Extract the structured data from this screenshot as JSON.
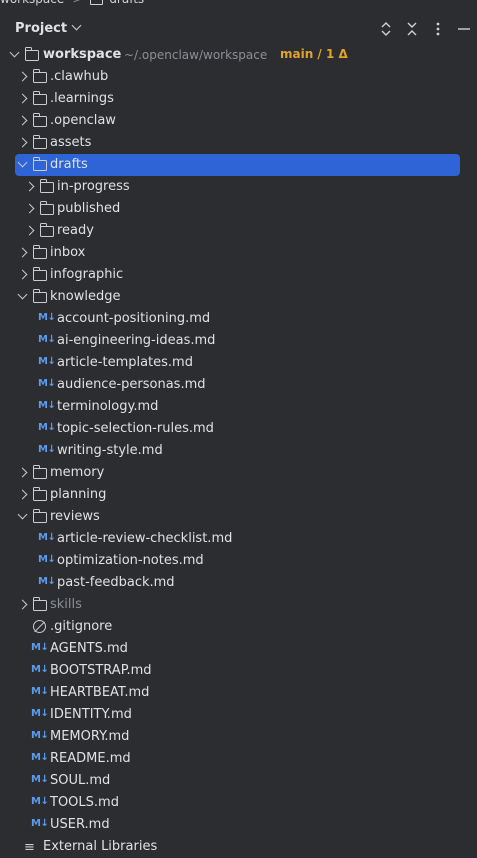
{
  "breadcrumb": {
    "items": [
      "workspace",
      "drafts"
    ]
  },
  "panel": {
    "title": "Project"
  },
  "toolbar": {
    "icons": [
      "chevron-up-down-icon",
      "collapse-all-icon",
      "more-options-icon",
      "minimize-icon"
    ]
  },
  "root": {
    "label": "workspace",
    "path": "~/.openclaw/workspace",
    "branch": "main / 1 Δ"
  },
  "tree": [
    {
      "label": ".clawhub",
      "type": "folder",
      "state": "closed"
    },
    {
      "label": ".learnings",
      "type": "folder",
      "state": "closed"
    },
    {
      "label": ".openclaw",
      "type": "folder",
      "state": "closed"
    },
    {
      "label": "assets",
      "type": "folder",
      "state": "closed"
    },
    {
      "label": "drafts",
      "type": "folder",
      "state": "open",
      "selected": true
    },
    {
      "label": "in-progress",
      "type": "folder",
      "state": "closed"
    },
    {
      "label": "published",
      "type": "folder",
      "state": "closed"
    },
    {
      "label": "ready",
      "type": "folder",
      "state": "closed"
    },
    {
      "label": "inbox",
      "type": "folder",
      "state": "closed"
    },
    {
      "label": "infographic",
      "type": "folder",
      "state": "closed"
    },
    {
      "label": "knowledge",
      "type": "folder",
      "state": "open"
    },
    {
      "label": "account-positioning.md",
      "type": "md"
    },
    {
      "label": "ai-engineering-ideas.md",
      "type": "md"
    },
    {
      "label": "article-templates.md",
      "type": "md"
    },
    {
      "label": "audience-personas.md",
      "type": "md"
    },
    {
      "label": "terminology.md",
      "type": "md"
    },
    {
      "label": "topic-selection-rules.md",
      "type": "md"
    },
    {
      "label": "writing-style.md",
      "type": "md"
    },
    {
      "label": "memory",
      "type": "folder",
      "state": "closed"
    },
    {
      "label": "planning",
      "type": "folder",
      "state": "closed"
    },
    {
      "label": "reviews",
      "type": "folder",
      "state": "open"
    },
    {
      "label": "article-review-checklist.md",
      "type": "md"
    },
    {
      "label": "optimization-notes.md",
      "type": "md"
    },
    {
      "label": "past-feedback.md",
      "type": "md"
    },
    {
      "label": "skills",
      "type": "folder",
      "state": "closed",
      "dim": true
    },
    {
      "label": ".gitignore",
      "type": "ignored"
    },
    {
      "label": "AGENTS.md",
      "type": "md"
    },
    {
      "label": "BOOTSTRAP.md",
      "type": "md"
    },
    {
      "label": "HEARTBEAT.md",
      "type": "md"
    },
    {
      "label": "IDENTITY.md",
      "type": "md"
    },
    {
      "label": "MEMORY.md",
      "type": "md"
    },
    {
      "label": "README.md",
      "type": "md"
    },
    {
      "label": "SOUL.md",
      "type": "md"
    },
    {
      "label": "TOOLS.md",
      "type": "md"
    },
    {
      "label": "USER.md",
      "type": "md"
    },
    {
      "label": "External Libraries",
      "type": "library"
    }
  ],
  "md_badge": "M↓",
  "colors": {
    "background": "#2b2d30",
    "selection": "#2e64d6",
    "md_icon": "#5b9bf0",
    "branch": "#e0a42e",
    "muted": "#8c8f94"
  }
}
